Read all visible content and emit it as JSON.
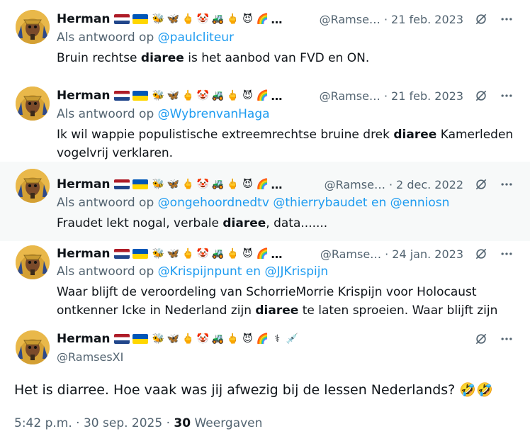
{
  "colors": {
    "link": "#1d9bf0",
    "muted": "#536471",
    "text": "#0f1419"
  },
  "icons": [
    "flag-nl",
    "flag-ua",
    "bee",
    "butterfly",
    "middle-finger",
    "clown",
    "tractor",
    "devil",
    "rainbow",
    "staff-of-aesculapius",
    "syringe",
    "grok-icon",
    "more-icon"
  ],
  "tweets": [
    {
      "name": "Herman",
      "handle": "@Ramse…",
      "date": "21 feb. 2023",
      "reply_prefix": "Als antwoord op",
      "reply_to": "@paulcliteur",
      "reply_mid": "",
      "reply_to2": "",
      "reply_mid2": "",
      "reply_to3": "",
      "text_a": "Bruin rechtse ",
      "text_bold": "diaree",
      "text_b": " is het aanbod van FVD en ON."
    },
    {
      "name": "Herman",
      "handle": "@Ramse…",
      "date": "21 feb. 2023",
      "reply_prefix": "Als antwoord op",
      "reply_to": "@WybrenvanHaga",
      "text_a": "Ik wil wappie populistische extreemrechtse bruine drek ",
      "text_bold": "diaree",
      "text_b": " Kamerleden vogelvrij verklaren."
    },
    {
      "name": "Herman",
      "handle": "@Ramse…",
      "date": "2 dec. 2022",
      "reply_prefix": "Als antwoord op",
      "reply_to": "@ongehoordnedtv",
      "reply_to2": "@thierrybaudet",
      "reply_mid": "en",
      "reply_to3": "@enniosn",
      "text_a": "Fraudet lekt nogal, verbale ",
      "text_bold": "diaree",
      "text_b": ", data......."
    },
    {
      "name": "Herman",
      "handle": "@Ramse…",
      "date": "24 jan. 2023",
      "reply_prefix": "Als antwoord op",
      "reply_to": "@Krispijnpunt",
      "reply_mid": "en",
      "reply_to2": "@JJKrispijn",
      "text_a": "Waar blijft de veroordeling van SchorrieMorrie Krispijn voor Holocaust ontkenner Icke in Nederland zijn ",
      "text_bold": "diaree",
      "text_b": " te laten sproeien. Waar blijft zijn"
    }
  ],
  "main": {
    "name": "Herman",
    "handle": "@RamsesXI",
    "text": "Het is diarree. Hoe vaak was jij afwezig bij de lessen Nederlands? 🤣🤣",
    "time": "5:42 p.m.",
    "sep": "·",
    "date": "30 sep. 2025",
    "views_count": "30",
    "views_label": "Weergaven"
  },
  "ellipsis": "…",
  "dot": "·"
}
